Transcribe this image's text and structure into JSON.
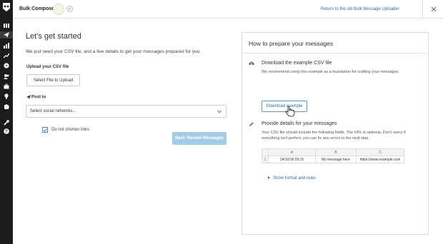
{
  "sidebar": {
    "logo_icon": "owl-logo-icon",
    "items": [
      {
        "icon": "streams-icon",
        "active": false
      },
      {
        "icon": "publisher-send-icon",
        "active": true
      },
      {
        "icon": "analytics-bars-icon",
        "active": false
      },
      {
        "icon": "trending-up-icon",
        "active": false
      },
      {
        "icon": "compass-icon",
        "active": false
      },
      {
        "icon": "contacts-icon",
        "active": false
      },
      {
        "icon": "briefcase-icon",
        "active": false
      },
      {
        "icon": "lightbulb-icon",
        "active": false
      },
      {
        "icon": "puzzle-icon",
        "active": false
      },
      {
        "icon": "wrench-icon",
        "active": false
      },
      {
        "icon": "help-icon",
        "active": false
      }
    ]
  },
  "topbar": {
    "title": "Bulk Composer",
    "return_link": "Return to the old Bulk Message Uploader",
    "close_icon": "close-icon"
  },
  "left": {
    "heading": "Let's get started",
    "intro": "We just need your CSV file, and a few details to get your messages prepared for you.",
    "upload_label": "Upload your CSV file",
    "upload_button": "Select File to Upload",
    "post_to_label": "Post to",
    "networks_placeholder": "Select social networks...",
    "shorten_label": "Do not shorten links",
    "shorten_checked": true,
    "next_button": "Next: Review Messages"
  },
  "card": {
    "title": "How to prepare your messages",
    "step1": {
      "title": "Download the example CSV file",
      "desc": "We recommend using this example as a foundation for crafting your messages.",
      "button": "Download example"
    },
    "step2": {
      "title": "Provide details for your messages",
      "desc": "Your CSV file should include the following fields. The URL is optional. Don't worry if everything isn't perfect, you can fix any errors in the next step."
    },
    "table": {
      "columns": [
        "A",
        "B",
        "C"
      ],
      "rows": [
        [
          "1",
          "24/10/16 09:15",
          "My message here",
          "https://www.example.com"
        ]
      ]
    },
    "show_rules": "Show format and rules"
  },
  "colors": {
    "accent": "#2b6d96",
    "sidebar": "#1c1c1c",
    "disabled_button": "#a5cce6"
  }
}
